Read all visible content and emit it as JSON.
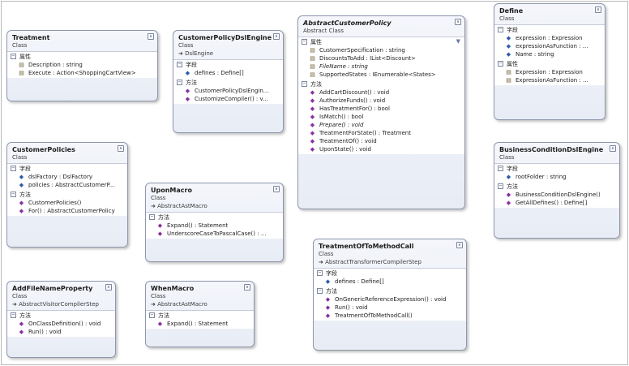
{
  "labels": {
    "fields": "字段",
    "properties": "属性",
    "methods": "方法"
  },
  "colors": {
    "frame": "#b9b9b9",
    "box_border": "#8e97ad",
    "header_bg": "#e8ecf5",
    "method_icon": "#8a2fa0",
    "field_icon": "#2a5ca8",
    "property_icon": "#6b5c2a"
  },
  "classes": {
    "treatment": {
      "name": "Treatment",
      "kind": "Class",
      "props": [
        "Description : string",
        "Execute : Action<ShoppingCartView>"
      ]
    },
    "customerPolicyDslEngine": {
      "name": "CustomerPolicyDslEngine",
      "kind": "Class",
      "base": "DslEngine",
      "fields": [
        "defines : Define[]"
      ],
      "methods": [
        "CustomerPolicyDslEngin...",
        "CustomizeCompiler() : v..."
      ]
    },
    "abstractCustomerPolicy": {
      "name": "AbstractCustomerPolicy",
      "kind": "Abstract Class",
      "props": [
        "CustomerSpecification : string",
        "DiscountsToAdd : IList<Discount>",
        "FileName : string",
        "SupportedStates : IEnumerable<States>"
      ],
      "methods": [
        "AddCartDiscount() : void",
        "AuthorizeFunds() : void",
        "HasTreatmentFor() : bool",
        "IsMatch() : bool",
        "Prepare() : void",
        "TreatmentForState() : Treatment",
        "TreatmentOf() : void",
        "UponState() : void"
      ]
    },
    "define": {
      "name": "Define",
      "kind": "Class",
      "fields": [
        "expression : Expression",
        "expressionAsFunction : ...",
        "Name : string"
      ],
      "props": [
        "Expression : Expression",
        "ExpressionAsFunction : ..."
      ]
    },
    "customerPolicies": {
      "name": "CustomerPolicies",
      "kind": "Class",
      "fields": [
        "dslFactory : DslFactory",
        "policies : AbstractCustomerP..."
      ],
      "methods": [
        "CustomerPolicies()",
        "For() : AbstractCustomerPolicy"
      ]
    },
    "uponMacro": {
      "name": "UponMacro",
      "kind": "Class",
      "base": "AbstractAstMacro",
      "methods": [
        "Expand() : Statement",
        "UnderscoreCaseToPascalCase() : ..."
      ]
    },
    "businessConditionDslEngine": {
      "name": "BusinessConditionDslEngine",
      "kind": "Class",
      "fields": [
        "rootFolder : string"
      ],
      "methods": [
        "BusinessConditionDslEngine()",
        "GetAllDefines() : Define[]"
      ]
    },
    "addFileNameProperty": {
      "name": "AddFileNameProperty",
      "kind": "Class",
      "base": "AbstractVisitorCompilerStep",
      "methods": [
        "OnClassDefinition() : void",
        "Run() : void"
      ]
    },
    "whenMacro": {
      "name": "WhenMacro",
      "kind": "Class",
      "base": "AbstractAstMacro",
      "methods": [
        "Expand() : Statement"
      ]
    },
    "treatmentOfToMethodCall": {
      "name": "TreatmentOfToMethodCall",
      "kind": "Class",
      "base": "AbstractTransformerCompilerStep",
      "fields": [
        "defines : Define[]"
      ],
      "methods": [
        "OnGenericReferenceExpression() : void",
        "Run() : void",
        "TreatmentOfToMethodCall()"
      ]
    }
  }
}
